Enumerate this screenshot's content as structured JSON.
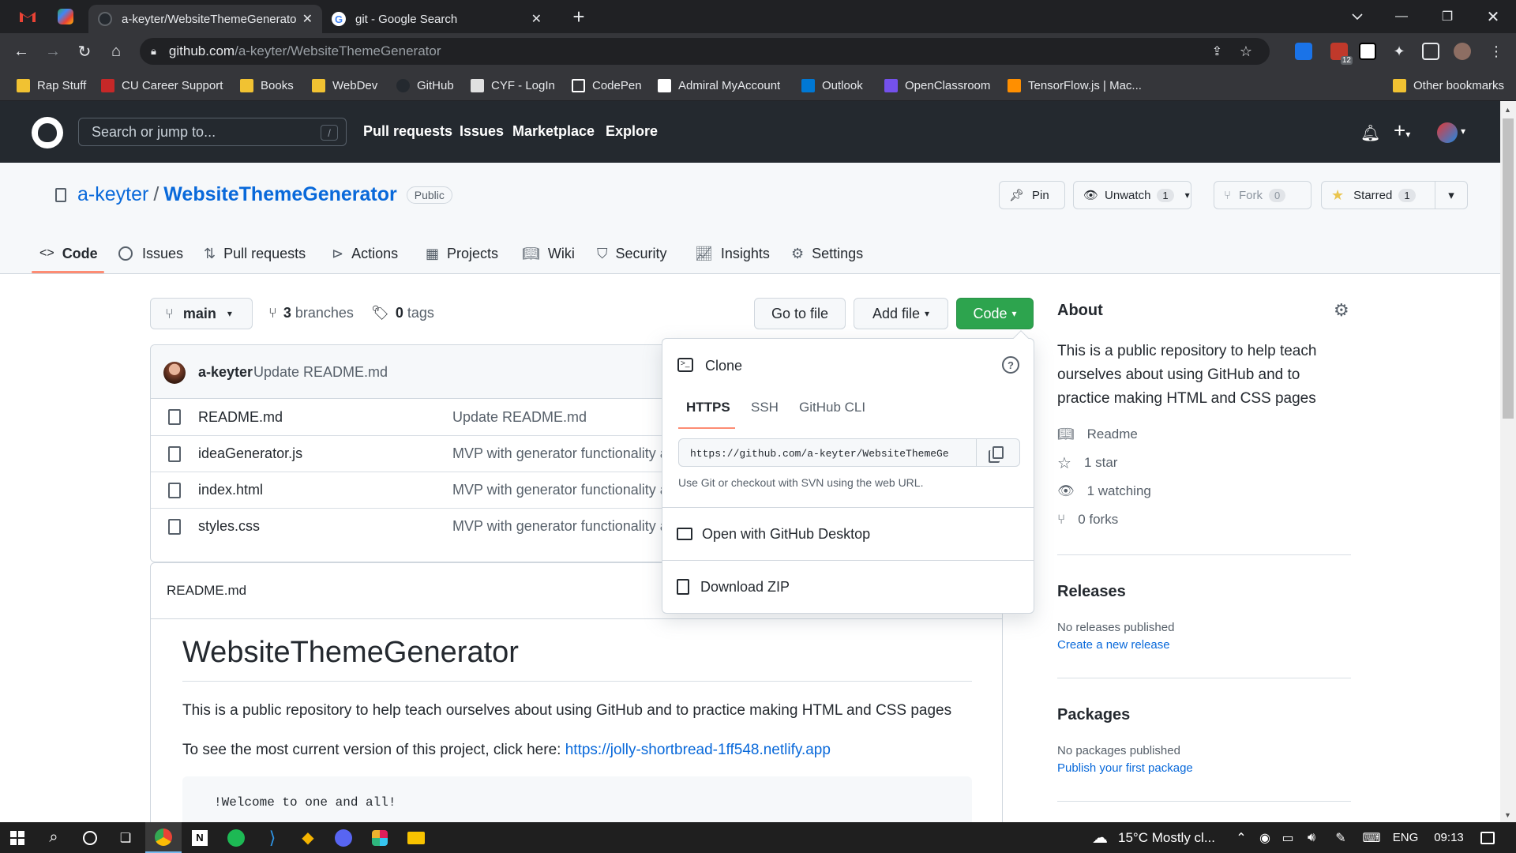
{
  "browser": {
    "tabs": [
      {
        "title": "a-keyter/WebsiteThemeGenerato"
      },
      {
        "title": "git - Google Search"
      }
    ],
    "url_host": "github.com",
    "url_path": "/a-keyter/WebsiteThemeGenerator",
    "extension_badge": "12",
    "bookmarks": [
      "Rap Stuff",
      "CU Career Support",
      "Books",
      "WebDev",
      "GitHub",
      "CYF - LogIn",
      "CodePen",
      "Admiral MyAccount",
      "Outlook",
      "OpenClassroom",
      "TensorFlow.js | Mac..."
    ],
    "other_bookmarks": "Other bookmarks"
  },
  "github": {
    "search_placeholder": "Search or jump to...",
    "search_shortcut": "/",
    "nav": [
      "Pull requests",
      "Issues",
      "Marketplace",
      "Explore"
    ]
  },
  "repo": {
    "owner": "a-keyter",
    "separator": "/",
    "name": "WebsiteThemeGenerator",
    "visibility": "Public",
    "pin_label": "Pin",
    "unwatch_label": "Unwatch",
    "watch_count": "1",
    "fork_label": "Fork",
    "fork_count": "0",
    "starred_label": "Starred",
    "star_count": "1",
    "tabs": [
      "Code",
      "Issues",
      "Pull requests",
      "Actions",
      "Projects",
      "Wiki",
      "Security",
      "Insights",
      "Settings"
    ]
  },
  "main": {
    "branch": "main",
    "branches_count": "3",
    "branches_label": "branches",
    "tags_count": "0",
    "tags_label": "tags",
    "go_to_file": "Go to file",
    "add_file": "Add file",
    "code_button": "Code",
    "commit_author": "a-keyter",
    "commit_message": "Update README.md",
    "files": [
      {
        "name": "README.md",
        "message": "Update README.md"
      },
      {
        "name": "ideaGenerator.js",
        "message": "MVP with generator functionality a"
      },
      {
        "name": "index.html",
        "message": "MVP with generator functionality a"
      },
      {
        "name": "styles.css",
        "message": "MVP with generator functionality a"
      }
    ]
  },
  "clone": {
    "title": "Clone",
    "tabs": [
      "HTTPS",
      "SSH",
      "GitHub CLI"
    ],
    "url": "https://github.com/a-keyter/WebsiteThemeGe",
    "hint": "Use Git or checkout with SVN using the web URL.",
    "desktop": "Open with GitHub Desktop",
    "zip": "Download ZIP"
  },
  "readme": {
    "file_label": "README.md",
    "heading": "WebsiteThemeGenerator",
    "paragraph": "This is a public repository to help teach ourselves about using GitHub and to practice making HTML and CSS pages",
    "link_prefix": "To see the most current version of this project, click here:",
    "link": "https://jolly-shortbread-1ff548.netlify.app",
    "code_line": "!Welcome to one and all!"
  },
  "about": {
    "title": "About",
    "description": "This is a public repository to help teach ourselves about using GitHub and to practice making HTML and CSS pages",
    "readme": "Readme",
    "stars": "1 star",
    "watching": "1 watching",
    "forks": "0 forks",
    "releases_title": "Releases",
    "releases_empty": "No releases published",
    "releases_link": "Create a new release",
    "packages_title": "Packages",
    "packages_empty": "No packages published",
    "packages_link": "Publish your first package"
  },
  "taskbar": {
    "weather": "15°C  Mostly cl...",
    "language": "ENG",
    "time": "09:13"
  },
  "colors": {
    "accent_green": "#2da44e",
    "link_blue": "#0969da",
    "tab_underline": "#fd8c73",
    "header_dark": "#24292f"
  }
}
